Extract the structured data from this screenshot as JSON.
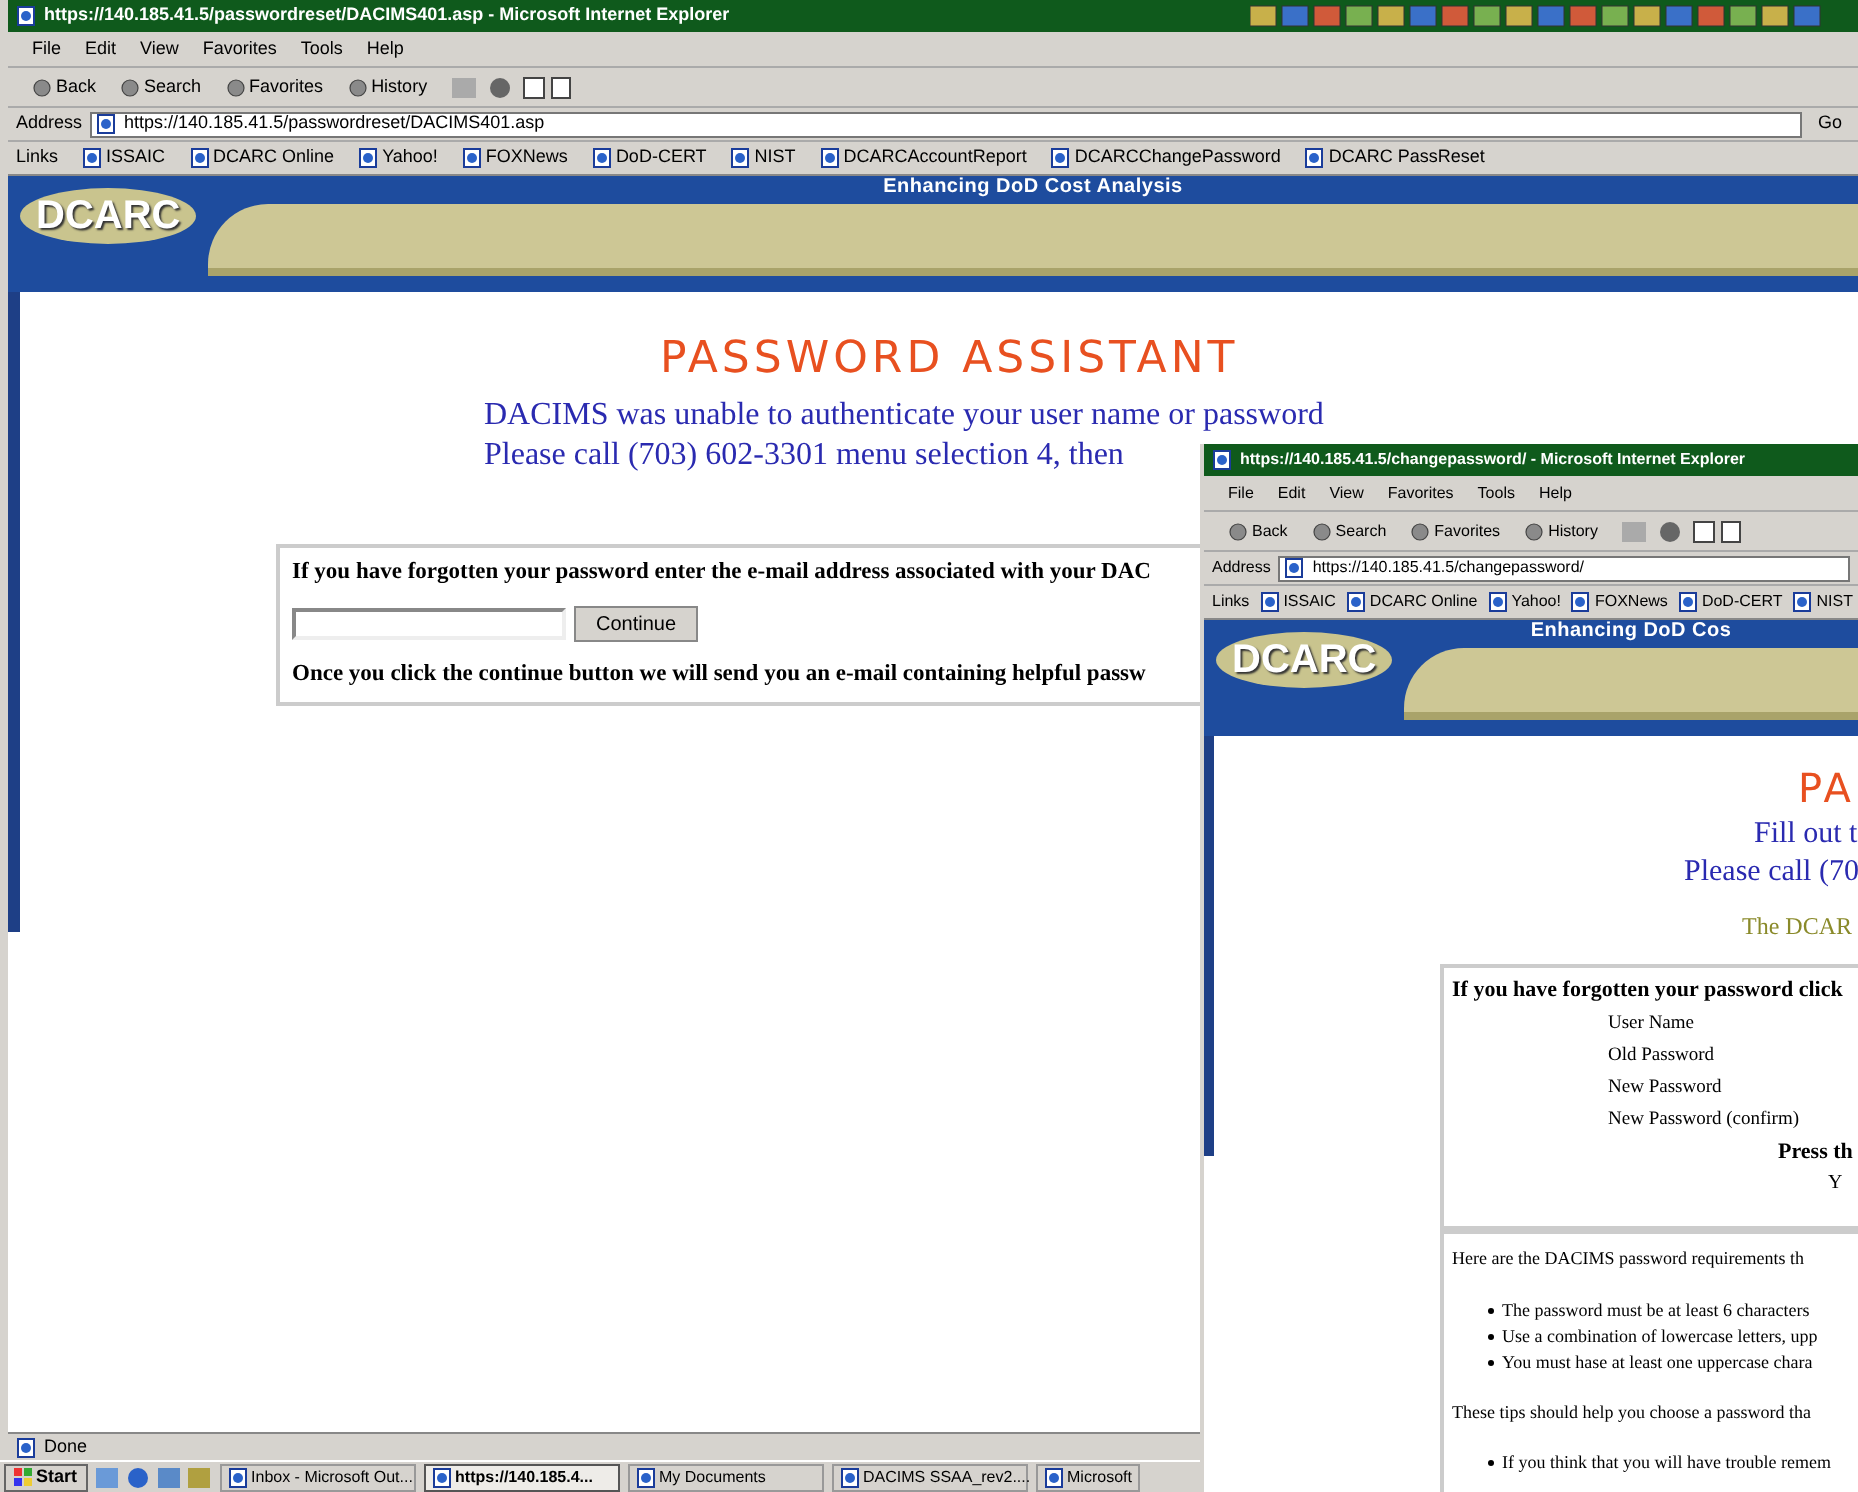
{
  "main_window": {
    "title": "https://140.185.41.5/passwordreset/DACIMS401.asp - Microsoft Internet Explorer",
    "menu": [
      "File",
      "Edit",
      "View",
      "Favorites",
      "Tools",
      "Help"
    ],
    "toolbar": [
      "Back",
      "Search",
      "Favorites",
      "History"
    ],
    "address": {
      "label": "Address",
      "url": "https://140.185.41.5/passwordreset/DACIMS401.asp",
      "go": "Go"
    },
    "links": {
      "label": "Links",
      "items": [
        "ISSAIC",
        "DCARC Online",
        "Yahoo!",
        "FOXNews",
        "DoD-CERT",
        "NIST",
        "DCARCAccountReport",
        "DCARCChangePassword",
        "DCARC PassReset"
      ]
    },
    "banner": {
      "logo": "DCARC",
      "tagline": "Enhancing DoD Cost Analysis"
    },
    "heading": "PASSWORD ASSISTANT",
    "messages": [
      "DACIMS was unable to authenticate your user name or password",
      "Please call (703) 602-3301 menu selection 4, then"
    ],
    "form": {
      "prompt": "If you have forgotten your password enter the e-mail address associated with your DAC",
      "button": "Continue",
      "note": "Once you click the continue button we will send you an e-mail containing helpful passw"
    },
    "status": "Done"
  },
  "taskbar": {
    "start": "Start",
    "items": [
      {
        "label": "Inbox - Microsoft Out...",
        "selected": false
      },
      {
        "label": "https://140.185.4...",
        "selected": true
      },
      {
        "label": "My Documents",
        "selected": false
      },
      {
        "label": "DACIMS SSAA_rev2....",
        "selected": false
      },
      {
        "label": "Microsoft",
        "selected": false
      }
    ]
  },
  "second_window": {
    "title": "https://140.185.41.5/changepassword/ - Microsoft Internet Explorer",
    "menu": [
      "File",
      "Edit",
      "View",
      "Favorites",
      "Tools",
      "Help"
    ],
    "toolbar": [
      "Back",
      "Search",
      "Favorites",
      "History"
    ],
    "address": {
      "label": "Address",
      "url": "https://140.185.41.5/changepassword/"
    },
    "links": {
      "label": "Links",
      "items": [
        "ISSAIC",
        "DCARC Online",
        "Yahoo!",
        "FOXNews",
        "DoD-CERT",
        "NIST"
      ]
    },
    "banner": {
      "logo": "DCARC",
      "tagline": "Enhancing DoD Cos"
    },
    "heading": "PA",
    "messages": [
      "Fill out t",
      "Please call (70"
    ],
    "notice": "The DCAR",
    "form": {
      "prompt": "If you have forgotten your password click",
      "fields": [
        "User Name",
        "Old Password",
        "New Password",
        "New Password (confirm)"
      ],
      "press": "Press th",
      "line": "Y"
    },
    "requirements": {
      "intro": "Here are the DACIMS password requirements th",
      "items": [
        "The password must be at least 6 characters",
        "Use a combination of lowercase letters, upp",
        "You must hase at least one uppercase chara"
      ]
    },
    "tips": {
      "intro": "These tips should help you choose a password tha",
      "items": [
        "If you think that you will have trouble remem"
      ]
    }
  }
}
